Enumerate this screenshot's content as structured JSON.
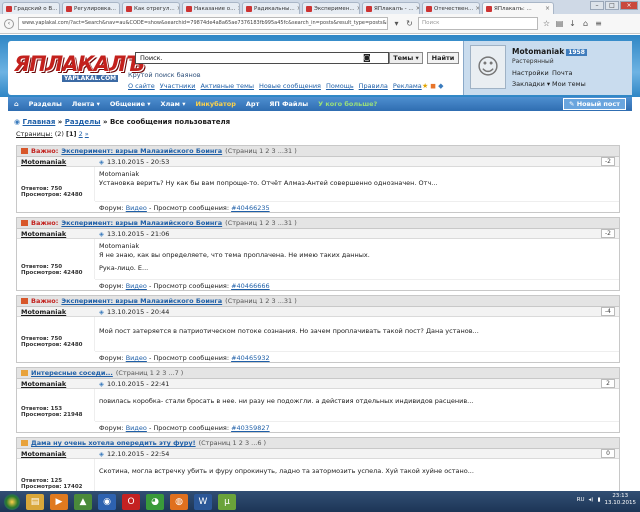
{
  "browser": {
    "tabs": [
      {
        "label": "Градский о В..."
      },
      {
        "label": "Регулировка..."
      },
      {
        "label": "Как отрегул..."
      },
      {
        "label": "Наказание о..."
      },
      {
        "label": "Радикальны..."
      },
      {
        "label": "Эксперимен..."
      },
      {
        "label": "ЯПлакалъ - ..."
      },
      {
        "label": "Отечествен..."
      },
      {
        "label": "ЯПлакалъ: ..."
      }
    ],
    "url": "www.yaplakal.com/?act=Search&nav=au&CODE=show&searchid=79874de4a8a65ae7376183fb995a45fc&search_in=posts&result_type=posts&highlite=",
    "search_placeholder": "Поиск"
  },
  "header": {
    "logo_text": "ЯПЛАКАЛЪ",
    "logo_sub": "YAPLAKAL.COM",
    "search_value": "Поиск.",
    "themes_label": "Темы",
    "find_label": "Найти",
    "slogan": "Крутой поиск баянов",
    "links": [
      "О сайте",
      "Участники",
      "Активные темы",
      "Новые сообщения",
      "Помощь",
      "Правила",
      "Реклама"
    ]
  },
  "user": {
    "name": "Motomaniak",
    "number": "1958",
    "rank": "Растерянный",
    "links": [
      "Настройки",
      "Почта",
      "Закладки ▾",
      "Мои темы"
    ]
  },
  "menu": {
    "items": [
      "Разделы",
      "Лента ▾",
      "Общение ▾",
      "Хлам ▾",
      "Инкубатор",
      "Арт",
      "ЯП Файлы",
      "У кого больше?"
    ],
    "new_post": "Новый пост"
  },
  "breadcrumb": {
    "home": "Главная",
    "sections": "Разделы",
    "current": "Все сообщения пользователя"
  },
  "pagination": {
    "label": "Страницы:",
    "count": "(2)",
    "current": "[1]",
    "next": "2",
    "more": "»"
  },
  "posts": [
    {
      "important": "Важно:",
      "title": "Эксперимент: взрыв Малазийского Боинга",
      "pages": "(Страниц 1 2 3 ...31 )",
      "author": "Motomaniak",
      "date": "13.10.2015 - 20:53",
      "rating": "-2",
      "answers": "Ответов: 750",
      "views": "Просмотров: 42480",
      "lines": [
        "Motomaniak",
        "Установка верить? Ну как бы вам попроще-то. Отчёт Алмаз-Антей совершенно однозначен. Отч..."
      ],
      "forum_label": "Форум:",
      "forum": "Видео",
      "view_label": "Просмотр сообщения:",
      "post_id": "#40466235"
    },
    {
      "important": "Важно:",
      "title": "Эксперимент: взрыв Малазийского Боинга",
      "pages": "(Страниц 1 2 3 ...31 )",
      "author": "Motomaniak",
      "date": "13.10.2015 - 21:06",
      "rating": "-2",
      "answers": "Ответов: 750",
      "views": "Просмотров: 42480",
      "lines": [
        "Motomaniak",
        "Я не знаю, как вы определяете, что тема проплачена. Не имею таких данных.",
        "",
        "Рука-лицо. Е..."
      ],
      "forum_label": "Форум:",
      "forum": "Видео",
      "view_label": "Просмотр сообщения:",
      "post_id": "#40466666"
    },
    {
      "important": "Важно:",
      "title": "Эксперимент: взрыв Малазийского Боинга",
      "pages": "(Страниц 1 2 3 ...31 )",
      "author": "Motomaniak",
      "date": "13.10.2015 - 20:44",
      "rating": "-4",
      "answers": "Ответов: 750",
      "views": "Просмотров: 42480",
      "lines": [
        "Мой пост затеряется в патриотическом потоке сознания. Но зачем проплачивать такой пост? Дана установ..."
      ],
      "forum_label": "Форум:",
      "forum": "Видео",
      "view_label": "Просмотр сообщения:",
      "post_id": "#40465932"
    },
    {
      "important": "",
      "title": "Интересные соседи...",
      "pages": "(Страниц 1 2 3 ...7 )",
      "author": "Motomaniak",
      "date": "10.10.2015 - 22:41",
      "rating": "2",
      "answers": "Ответов: 153",
      "views": "Просмотров: 21948",
      "lines": [
        "повилась коробка- стали бросать в нее. ни разу не подожгли. а действия отдельных индивидов расценив..."
      ],
      "forum_label": "Форум:",
      "forum": "Видео",
      "view_label": "Просмотр сообщения:",
      "post_id": "#40359827"
    },
    {
      "important": "",
      "title": "Дама ну очень хотела опередить эту фуру!",
      "pages": "(Страниц 1 2 3 ...6 )",
      "author": "Motomaniak",
      "date": "12.10.2015 - 22:54",
      "rating": "0",
      "answers": "Ответов: 125",
      "views": "Просмотров: 17402",
      "lines": [
        "Скотина, могла встречку убить и фуру опрокинуть, ладно та затормозить успела. Хуй такой хуйне остано..."
      ],
      "forum_label": "",
      "forum": "",
      "view_label": "",
      "post_id": ""
    }
  ],
  "taskbar": {
    "lang": "RU",
    "time": "23:13",
    "date": "13.10.2015"
  },
  "colors": {
    "header_blue": "#2f86c5",
    "menu_blue": "#3a7ac0",
    "logo_red": "#c3211d",
    "link_blue": "#1e5fa8"
  }
}
